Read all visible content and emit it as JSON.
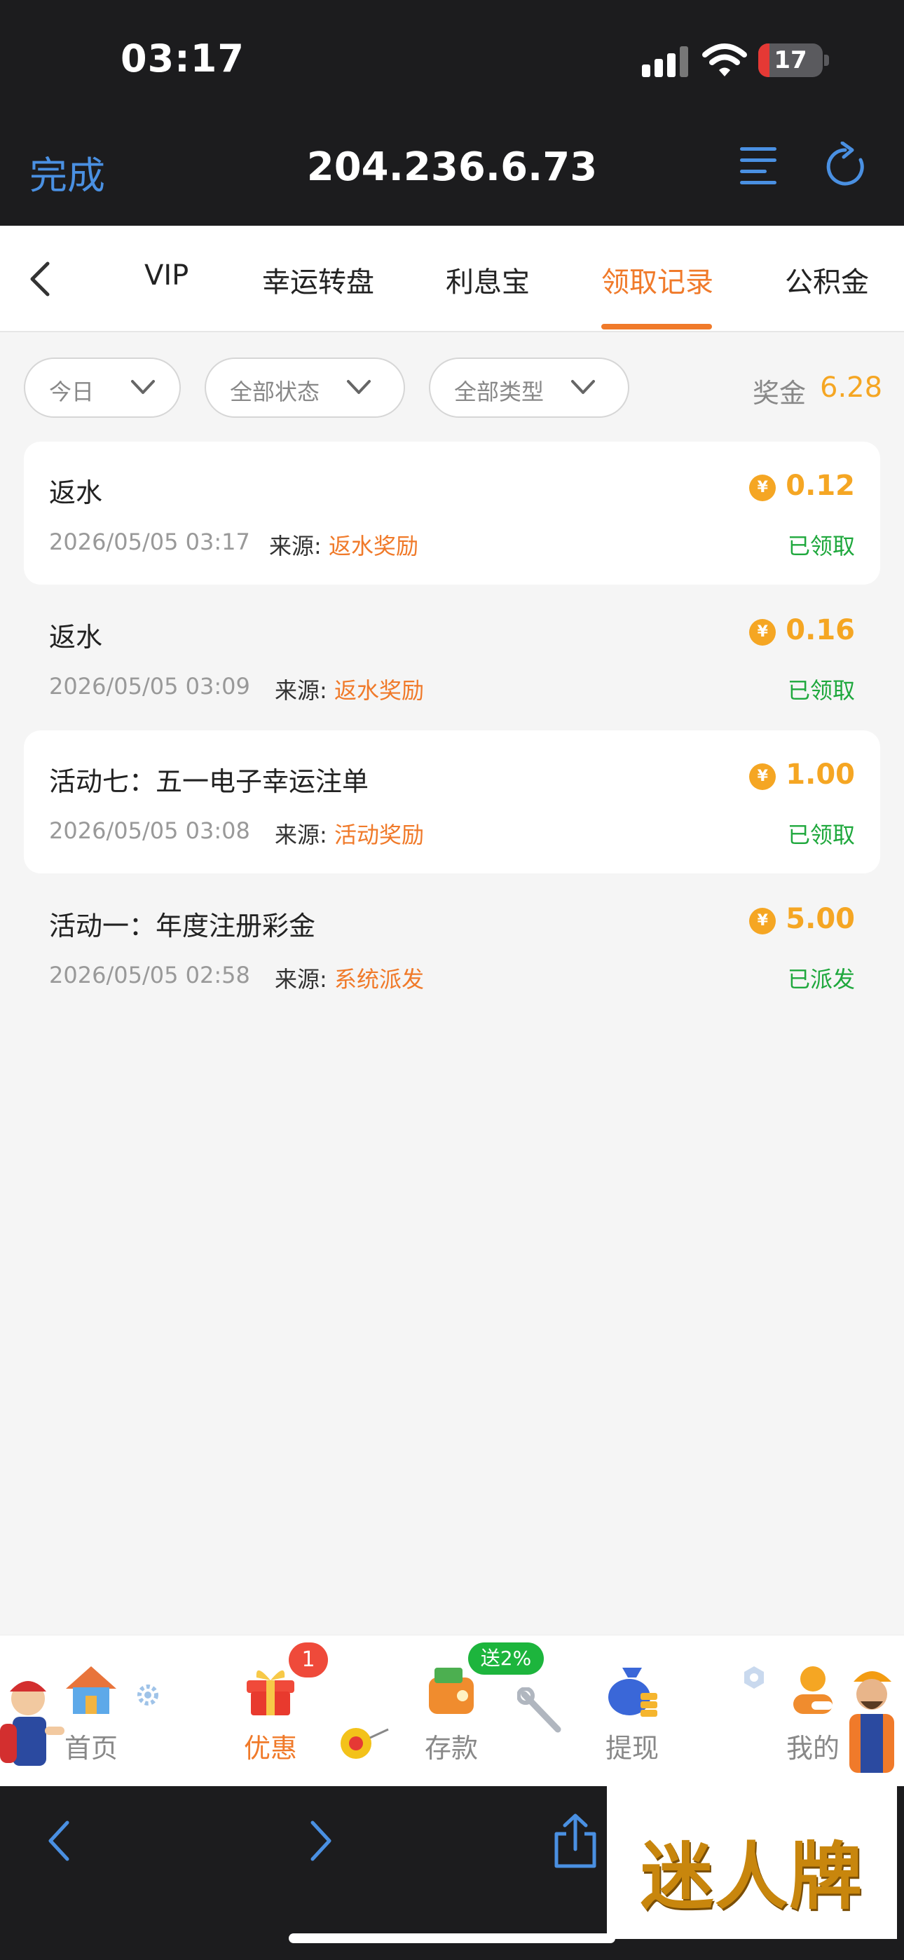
{
  "status_bar": {
    "time": "03:17",
    "battery": "17",
    "battery_level": 0.17,
    "battery_color": "#e53935"
  },
  "browser": {
    "done": "完成",
    "url": "204.236.6.73"
  },
  "tabs": [
    {
      "label": "VIP",
      "active": false
    },
    {
      "label": "幸运转盘",
      "active": false
    },
    {
      "label": "利息宝",
      "active": false
    },
    {
      "label": "领取记录",
      "active": true
    },
    {
      "label": "公积金",
      "active": false
    }
  ],
  "filters": [
    {
      "label": "今日"
    },
    {
      "label": "全部状态"
    },
    {
      "label": "全部类型"
    }
  ],
  "bonus": {
    "label": "奖金",
    "value": "6.28"
  },
  "records": [
    {
      "title": "返水",
      "date": "2026/05/05 03:17",
      "source_label": "来源:",
      "source": "返水奖励",
      "amount": "0.12",
      "status": "已领取",
      "coin": "¥"
    },
    {
      "title": "返水",
      "date": "2026/05/05 03:09",
      "source_label": "来源:",
      "source": "返水奖励",
      "amount": "0.16",
      "status": "已领取",
      "coin": "¥"
    },
    {
      "title": "活动七：五一电子幸运注单",
      "date": "2026/05/05 03:08",
      "source_label": "来源:",
      "source": "活动奖励",
      "amount": "1.00",
      "status": "已领取",
      "coin": "¥"
    },
    {
      "title": "活动一：年度注册彩金",
      "date": "2026/05/05 02:58",
      "source_label": "来源:",
      "source": "系统派发",
      "amount": "5.00",
      "status": "已派发",
      "coin": "¥"
    }
  ],
  "bottom_nav": {
    "items": [
      {
        "label": "首页",
        "icon": "house-icon"
      },
      {
        "label": "优惠",
        "icon": "gift-icon"
      },
      {
        "label": "存款",
        "icon": "wallet-icon"
      },
      {
        "label": "提现",
        "icon": "money-bag-icon"
      },
      {
        "label": "我的",
        "icon": "profile-icon"
      }
    ],
    "badge": "1",
    "promo": "送2%"
  },
  "watermark": "迷人牌",
  "colors": {
    "accent": "#f07a2a",
    "gold": "#f5a623",
    "success": "#1fa83d",
    "link": "#4a90e2"
  }
}
